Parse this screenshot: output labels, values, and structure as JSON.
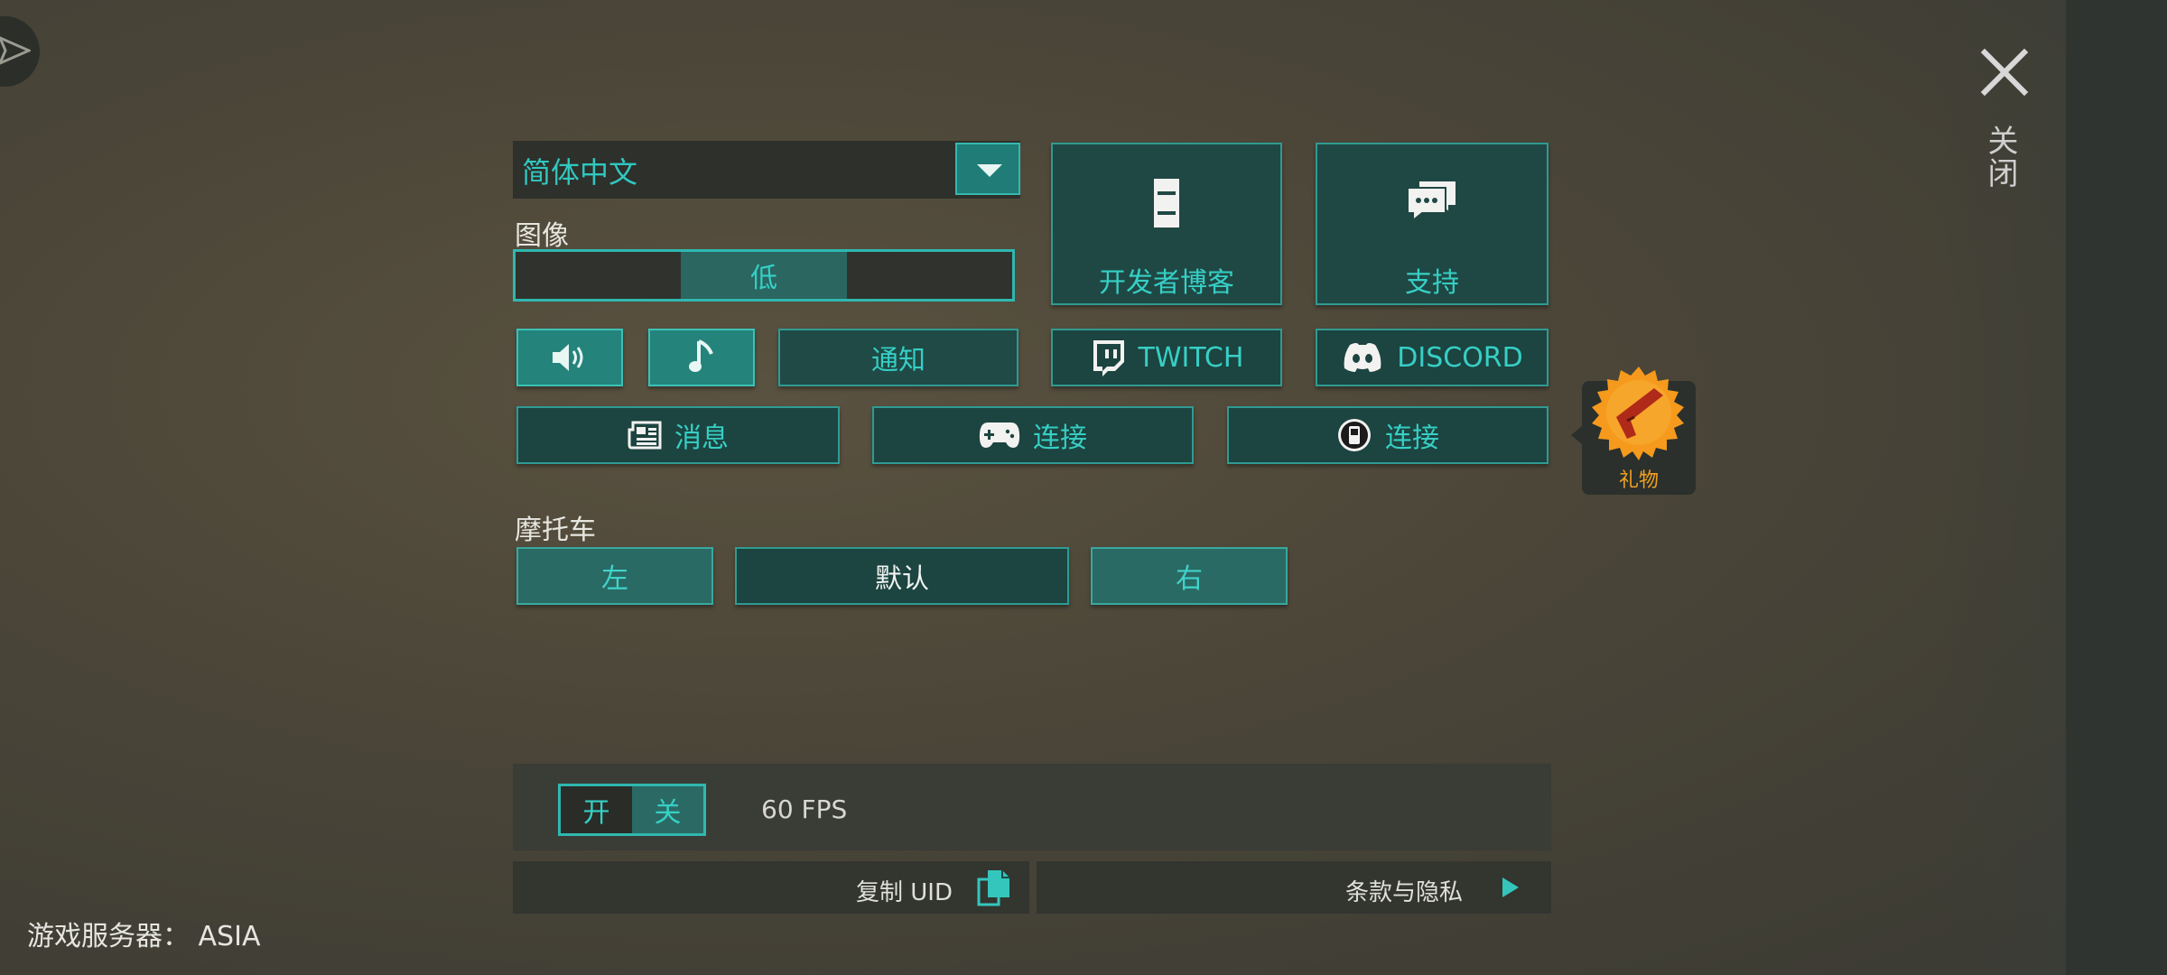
{
  "language_select": {
    "value": "简体中文"
  },
  "graphics": {
    "label": "图像",
    "options": [
      "",
      "低",
      ""
    ],
    "selected_index": 1
  },
  "tiles": {
    "dev_blog": "开发者博客",
    "support": "支持"
  },
  "audio": {
    "notify_label": "通知"
  },
  "social": {
    "twitch": "TWITCH",
    "discord": "DISCORD"
  },
  "row2": {
    "news": "消息",
    "connect_gamepad": "连接",
    "connect_device": "连接"
  },
  "gift": {
    "label": "礼物"
  },
  "motorcycle": {
    "label": "摩托车",
    "left": "左",
    "default": "默认",
    "right": "右"
  },
  "fps": {
    "on": "开",
    "off": "关",
    "value": "60 FPS"
  },
  "footer": {
    "copy_uid": "复制 UID",
    "terms": "条款与隐私",
    "server": "游戏服务器：  ASIA"
  },
  "close": {
    "label": "关闭"
  },
  "colors": {
    "accent": "#2fb8b0",
    "button_bg": "#1f4a46",
    "gift_text": "#f0a020"
  }
}
